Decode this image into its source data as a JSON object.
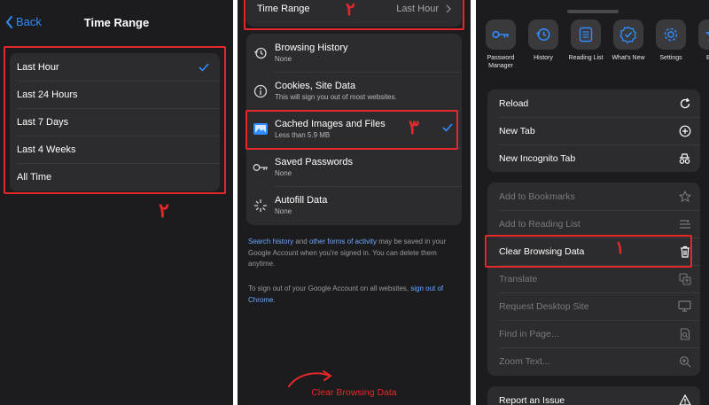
{
  "panel_time_range": {
    "back_label": "Back",
    "title": "Time Range",
    "options": [
      "Last Hour",
      "Last 24 Hours",
      "Last 7 Days",
      "Last 4 Weeks",
      "All Time"
    ],
    "selected": "Last Hour",
    "annotation": "۲"
  },
  "panel_clear_data": {
    "time_range_label": "Time Range",
    "time_range_value": "Last Hour",
    "annotation_top": "۲",
    "annotation_cached": "۳",
    "items": [
      {
        "title": "Browsing History",
        "subtitle": "None",
        "icon": "history-icon"
      },
      {
        "title": "Cookies, Site Data",
        "subtitle": "This will sign you out of most websites.",
        "icon": "info-icon"
      },
      {
        "title": "Cached Images and Files",
        "subtitle": "Less than 5.9 MB",
        "icon": "image-icon",
        "checked": true
      },
      {
        "title": "Saved Passwords",
        "subtitle": "None",
        "icon": "key-icon"
      },
      {
        "title": "Autofill Data",
        "subtitle": "None",
        "icon": "sparkle-icon"
      }
    ],
    "footer1": {
      "link1": "Search history",
      "t1": " and ",
      "link2": "other forms of activity",
      "t2": " may be saved in your Google Account when you're signed in. You can delete them anytime."
    },
    "footer2": {
      "t1": "To sign out of your Google Account on all websites, ",
      "link": "sign out of Chrome",
      "t2": "."
    },
    "clear_button": "Clear Browsing Data"
  },
  "panel_menu": {
    "tools": [
      {
        "label": "Password Manager",
        "icon": "key-icon"
      },
      {
        "label": "History",
        "icon": "history-icon"
      },
      {
        "label": "Reading List",
        "icon": "list-icon"
      },
      {
        "label": "What's New",
        "icon": "badge-check-icon"
      },
      {
        "label": "Settings",
        "icon": "gear-icon"
      },
      {
        "label": "Book",
        "icon": "star-icon"
      }
    ],
    "group1": [
      {
        "label": "Reload",
        "icon": "reload-icon"
      },
      {
        "label": "New Tab",
        "icon": "plus-circle-icon"
      },
      {
        "label": "New Incognito Tab",
        "icon": "incognito-icon"
      }
    ],
    "group2": [
      {
        "label": "Add to Bookmarks",
        "icon": "star-icon",
        "dim": true
      },
      {
        "label": "Add to Reading List",
        "icon": "reading-list-icon",
        "dim": true
      },
      {
        "label": "Clear Browsing Data",
        "icon": "trash-icon",
        "dim": false
      },
      {
        "label": "Translate",
        "icon": "translate-icon",
        "dim": true
      },
      {
        "label": "Request Desktop Site",
        "icon": "desktop-icon",
        "dim": true
      },
      {
        "label": "Find in Page...",
        "icon": "find-icon",
        "dim": true
      },
      {
        "label": "Zoom Text...",
        "icon": "zoom-icon",
        "dim": true
      }
    ],
    "report": {
      "label": "Report an Issue",
      "icon": "warning-icon"
    },
    "annotation": "۱"
  },
  "colors": {
    "background": "#1c1c1e",
    "group": "#2c2c2e",
    "accent": "#2f8cff",
    "annotation": "#e3282c"
  }
}
